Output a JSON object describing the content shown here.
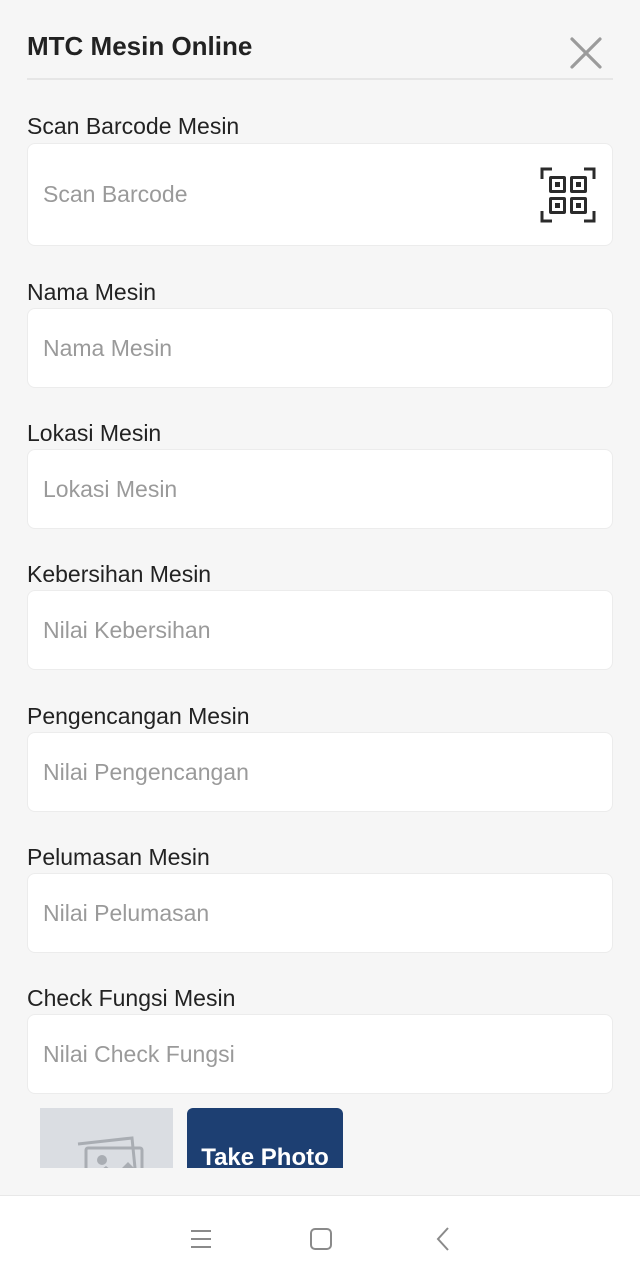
{
  "header": {
    "title": "MTC Mesin Online",
    "close_icon": "close-icon"
  },
  "fields": [
    {
      "label": "Scan Barcode Mesin",
      "placeholder": "Scan Barcode",
      "icon": "qr-code-icon"
    },
    {
      "label": "Nama Mesin",
      "placeholder": "Nama Mesin"
    },
    {
      "label": "Lokasi Mesin",
      "placeholder": "Lokasi Mesin"
    },
    {
      "label": "Kebersihan Mesin",
      "placeholder": "Nilai Kebersihan"
    },
    {
      "label": "Pengencangan Mesin",
      "placeholder": "Nilai Pengencangan"
    },
    {
      "label": "Pelumasan Mesin",
      "placeholder": "Nilai Pelumasan"
    },
    {
      "label": "Check Fungsi Mesin",
      "placeholder": "Nilai Check Fungsi"
    }
  ],
  "photo": {
    "thumbnail_icon": "image-placeholder-icon",
    "button_label": "Take Photo"
  },
  "colors": {
    "primary": "#1d3f72",
    "background": "#f6f6f6",
    "placeholder": "#9a9a9a"
  },
  "navbar": {
    "icons": [
      "menu-icon",
      "home-square-icon",
      "back-chevron-icon"
    ]
  }
}
